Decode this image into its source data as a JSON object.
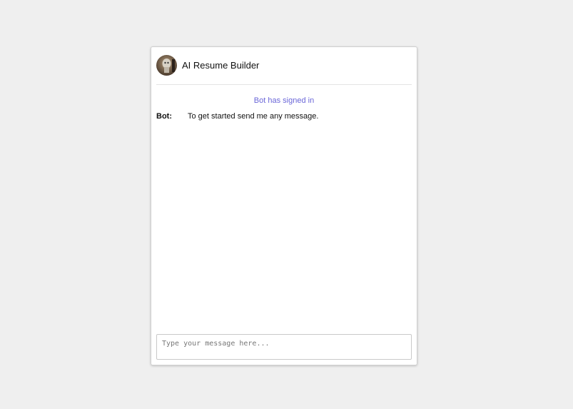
{
  "header": {
    "title": "AI Resume Builder",
    "avatar_icon": "robot-avatar-icon"
  },
  "messages": {
    "system_notice": "Bot has signed in",
    "items": [
      {
        "sender": "Bot:",
        "text": "To get started send me any message."
      }
    ]
  },
  "input": {
    "placeholder": "Type your message here...",
    "value": ""
  },
  "colors": {
    "system_notice": "#6a66d8",
    "page_background": "#efefef"
  }
}
